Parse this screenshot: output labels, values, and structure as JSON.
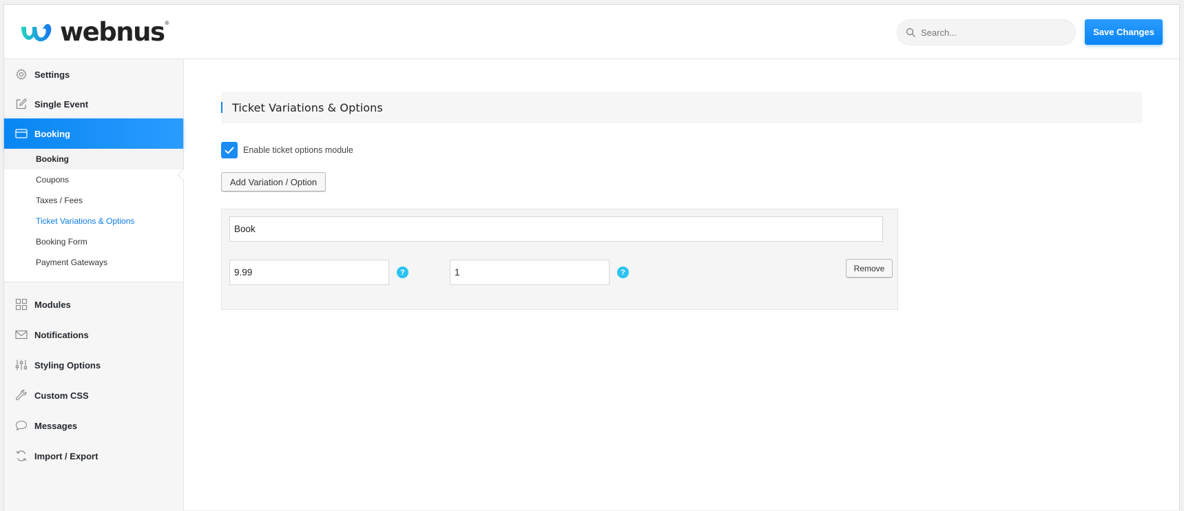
{
  "header": {
    "logo_text": "webnus",
    "logo_mark": "®",
    "search_placeholder": "Search...",
    "save_label": "Save Changes"
  },
  "sidebar": {
    "items": [
      {
        "label": "Settings",
        "icon": "gear-icon"
      },
      {
        "label": "Single Event",
        "icon": "edit-icon"
      },
      {
        "label": "Booking",
        "icon": "card-icon",
        "active": true
      },
      {
        "label": "Modules",
        "icon": "grid-icon"
      },
      {
        "label": "Notifications",
        "icon": "envelope-icon"
      },
      {
        "label": "Styling Options",
        "icon": "sliders-icon"
      },
      {
        "label": "Custom CSS",
        "icon": "wrench-icon"
      },
      {
        "label": "Messages",
        "icon": "chat-icon"
      },
      {
        "label": "Import / Export",
        "icon": "sync-icon"
      }
    ],
    "submenu": [
      {
        "label": "Booking"
      },
      {
        "label": "Coupons"
      },
      {
        "label": "Taxes / Fees"
      },
      {
        "label": "Ticket Variations & Options",
        "current": true
      },
      {
        "label": "Booking Form"
      },
      {
        "label": "Payment Gateways"
      }
    ]
  },
  "main": {
    "section_title": "Ticket Variations & Options",
    "enable_label": "Enable ticket options module",
    "enable_checked": true,
    "add_button": "Add Variation / Option",
    "variation": {
      "title_value": "Book",
      "price_value": "9.99",
      "max_value": "1",
      "help_glyph": "?",
      "remove_label": "Remove"
    }
  },
  "colors": {
    "accent": "#0a84f5",
    "help": "#2dc3f0",
    "logo_gradient_start": "#22d3c0",
    "logo_gradient_end": "#1877f2"
  }
}
